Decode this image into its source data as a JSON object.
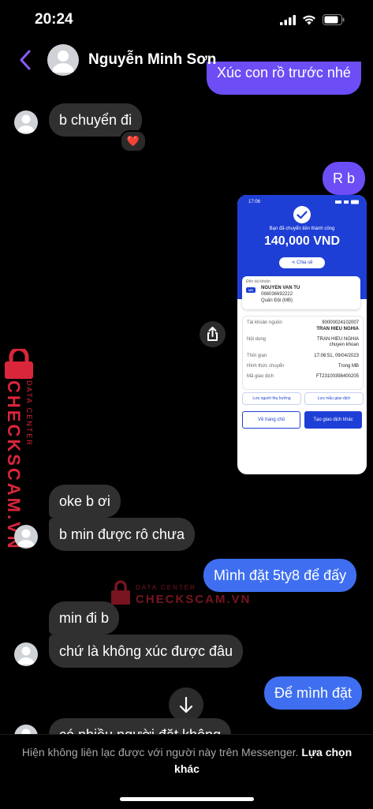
{
  "status_bar": {
    "time": "20:24"
  },
  "header": {
    "contact_name": "Nguyễn Minh Sơn"
  },
  "messages": {
    "m0_partial": "Xúc con rồ trước nhé",
    "m1": "b chuyển đi",
    "m1_reaction": "❤️",
    "m2": "R b",
    "m3": "oke b ơi",
    "m4": "b min được rô chưa",
    "m5": "Mình đặt 5ty8 để đấy",
    "m6": "min đi b",
    "m7": "chứ là không xúc được đâu",
    "m8": "Để mình đặt",
    "m9_partial": "có nhiều người đặt không"
  },
  "receipt": {
    "time": "17:06",
    "success_text": "Bạn đã chuyển tiền thành công",
    "amount": "140,000 VND",
    "share_label": "Chia sẻ",
    "to_label": "Đến tài khoản",
    "bank_short": "MB",
    "recipient_name": "NGUYEN VAN TU",
    "recipient_account": "066036692222",
    "recipient_bank": "Quân Đội (MB)",
    "source_label": "Tài khoản nguồn",
    "source_account": "90000024102007",
    "source_name": "TRAN HIEU NGHIA",
    "content_label": "Nội dung",
    "content_value_1": "TRAN HIEU NGHIA",
    "content_value_2": "chuyen khoan",
    "time_label": "Thời gian",
    "time_value": "17:06:51, 09/04/2023",
    "method_label": "Hình thức chuyển",
    "method_value": "Trong MB",
    "code_label": "Mã giao dịch",
    "code_value": "FT23100398400205",
    "save_beneficiary": "Lưu người thụ hưởng",
    "save_template": "Lưu mẫu giao dịch",
    "home_button": "Về trang chủ",
    "new_transaction": "Tạo giao dịch khác"
  },
  "watermark": {
    "brand": "CHECKSCAM.VN",
    "sub": "DATA CENTER"
  },
  "footer": {
    "notice": "Hiện không liên lạc được với người này trên Messenger.",
    "link": "Lựa chọn khác"
  },
  "colors": {
    "outgoing_purple": "#6d4df5",
    "outgoing_blue": "#3f6ff0",
    "incoming": "#303030",
    "watermark_red": "#d9263a"
  }
}
